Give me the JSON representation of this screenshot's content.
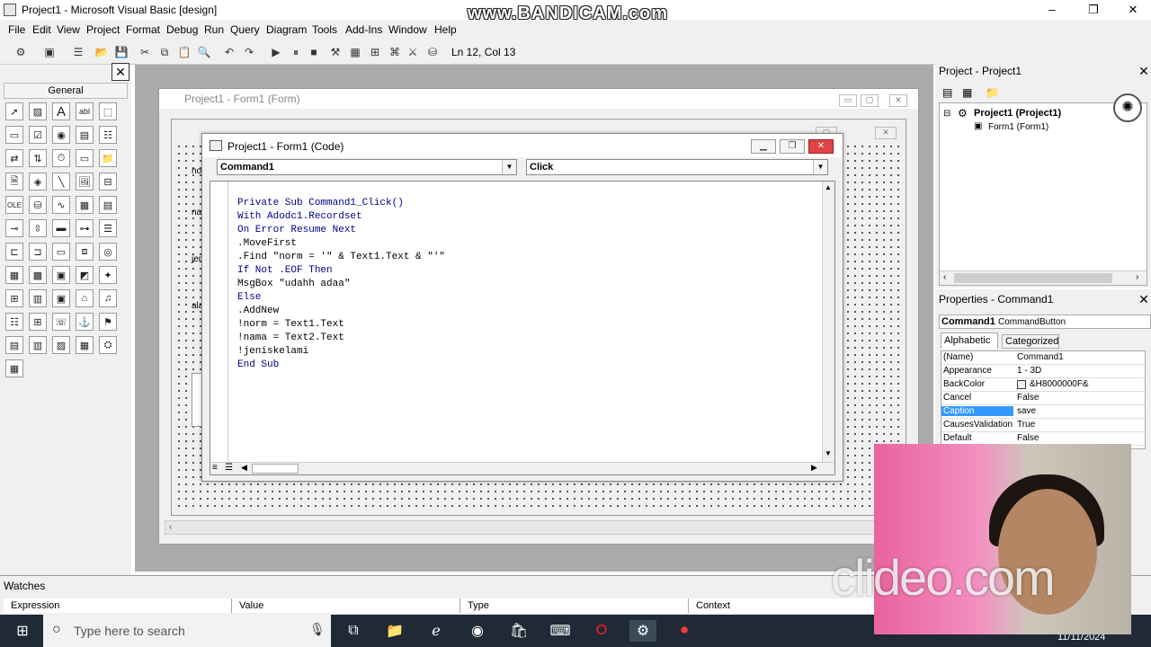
{
  "window": {
    "title": "Project1 - Microsoft Visual Basic [design]",
    "minimize": "–",
    "maximize": "❐",
    "close": "✕"
  },
  "watermark_top": "www.BANDICAM.com",
  "menu": [
    "File",
    "Edit",
    "View",
    "Project",
    "Format",
    "Debug",
    "Run",
    "Query",
    "Diagram",
    "Tools",
    "Add-Ins",
    "Window",
    "Help"
  ],
  "toolbar": {
    "position": "Ln 12, Col 13"
  },
  "toolbox": {
    "close": "✕",
    "tab": "General"
  },
  "form_window": {
    "title": "Project1 - Form1 (Form)"
  },
  "inner_form": {
    "labels": [
      "no",
      "na",
      "jen",
      "ala"
    ]
  },
  "code_window": {
    "title": "Project1 - Form1 (Code)",
    "object": "Command1",
    "procedure": "Click",
    "lines": [
      "Private Sub Command1_Click()",
      "With Adodc1.Recordset",
      "On Error Resume Next",
      ".MoveFirst",
      ".Find \"norm = '\" & Text1.Text & \"'\"",
      "If Not .EOF Then",
      "MsgBox \"udahh adaa\"",
      "Else",
      ".AddNew",
      "!norm = Text1.Text",
      "!nama = Text2.Text",
      "!jeniskelami",
      "End Sub"
    ]
  },
  "project_panel": {
    "title": "Project - Project1",
    "close": "✕",
    "root": "Project1 (Project1)",
    "child": "Form1 (Form1)"
  },
  "properties_panel": {
    "title": "Properties - Command1",
    "close": "✕",
    "object": "Command1",
    "object_type": "CommandButton",
    "tabs": [
      "Alphabetic",
      "Categorized"
    ],
    "rows": [
      {
        "name": "(Name)",
        "value": "Command1"
      },
      {
        "name": "Appearance",
        "value": "1 - 3D"
      },
      {
        "name": "BackColor",
        "value": "&H8000000F&"
      },
      {
        "name": "Cancel",
        "value": "False"
      },
      {
        "name": "Caption",
        "value": "save"
      },
      {
        "name": "CausesValidation",
        "value": "True"
      },
      {
        "name": "Default",
        "value": "False"
      }
    ],
    "selected_row": "Caption"
  },
  "watches": {
    "title": "Watches",
    "columns": [
      "Expression",
      "Value",
      "Type",
      "Context"
    ]
  },
  "taskbar": {
    "search_placeholder": "Type here to search",
    "date": "11/11/2024"
  },
  "watermark_bottom": "clideo.com",
  "colors": {
    "selection": "#3399ff",
    "keyword": "#00008b",
    "taskbar": "#1f2a36"
  }
}
